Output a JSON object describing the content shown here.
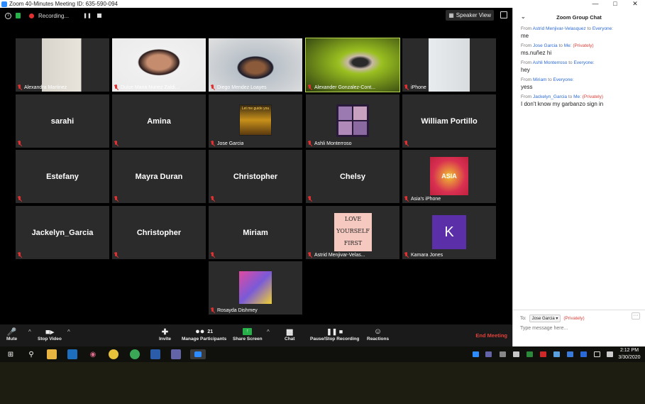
{
  "window": {
    "title": "Zoom 40-Minutes Meeting ID: 635-590-094"
  },
  "top": {
    "recording_label": "Recording...",
    "speaker_view_label": "Speaker View"
  },
  "participants": [
    {
      "name": "Alexandra Martinez",
      "type": "video"
    },
    {
      "name": "Dulce Maria Nunez Zaldi...",
      "type": "video"
    },
    {
      "name": "Diego Mendez Loayes",
      "type": "video"
    },
    {
      "name": "Alexander Gonzalez-Cont...",
      "type": "video",
      "active": true
    },
    {
      "name": "iPhone",
      "type": "video"
    },
    {
      "name": "sarahi",
      "type": "name"
    },
    {
      "name": "Amina",
      "type": "name"
    },
    {
      "name": "Jose Garcia",
      "type": "picture",
      "picture_text": "Let me guide you"
    },
    {
      "name": "Ashli Monterroso",
      "type": "picture"
    },
    {
      "name": "William Portillo",
      "type": "name"
    },
    {
      "name": "Estefany",
      "type": "name"
    },
    {
      "name": "Mayra Duran",
      "type": "name"
    },
    {
      "name": "Christopher",
      "type": "name"
    },
    {
      "name": "Chelsy",
      "type": "name"
    },
    {
      "name": "Asia's iPhone",
      "type": "picture",
      "picture_text": "ASIA"
    },
    {
      "name": "Jackelyn_Garcia",
      "type": "name"
    },
    {
      "name": "Christopher",
      "type": "name"
    },
    {
      "name": "Miriam",
      "type": "name"
    },
    {
      "name": "Astrid Menjivar-Velas...",
      "type": "picture",
      "picture_lines": [
        "LOVE",
        "YOURSELF",
        "FIRST"
      ]
    },
    {
      "name": "Kamara Jones",
      "type": "avatar",
      "initial": "K"
    },
    {
      "name": "Rosayda Dishmey",
      "type": "picture"
    }
  ],
  "toolbar": {
    "mute": "Mute",
    "stop_video": "Stop Video",
    "invite": "Invite",
    "manage_participants": "Manage Participants",
    "participant_count": "21",
    "share_screen": "Share Screen",
    "chat": "Chat",
    "pause_stop_recording": "Pause/Stop Recording",
    "reactions": "Reactions",
    "end_meeting": "End Meeting"
  },
  "chat": {
    "title": "Zoom Group Chat",
    "messages": [
      {
        "from": "Astrid Menjivar-Velasquez",
        "to": "Everyone",
        "private": false,
        "text": "me"
      },
      {
        "from": "Jose Garcia",
        "to": "Me",
        "private": true,
        "text": "ms.nuñez hi"
      },
      {
        "from": "Ashli Monterroso",
        "to": "Everyone",
        "private": false,
        "text": "hey"
      },
      {
        "from": "Miriam",
        "to": "Everyone",
        "private": false,
        "text": "yess"
      },
      {
        "from": "Jackelyn_Garcia",
        "to": "Me",
        "private": true,
        "text": "I don't know my garbanzo sign in"
      }
    ],
    "from_word": "From",
    "to_word": "to",
    "private_tag": "(Privately)",
    "to_label": "To:",
    "to_selected": "Jose Garcia",
    "to_private": "(Privately)",
    "input_placeholder": "Type message here..."
  },
  "taskbar": {
    "time": "2:12 PM",
    "date": "3/30/2020"
  },
  "colors": {
    "active_speaker": "#b8d84f",
    "end_meeting": "#e0403a",
    "chat_name": "#2d6ad8",
    "kamara_avatar": "#5b2fa8",
    "share_screen": "#27b04a"
  }
}
